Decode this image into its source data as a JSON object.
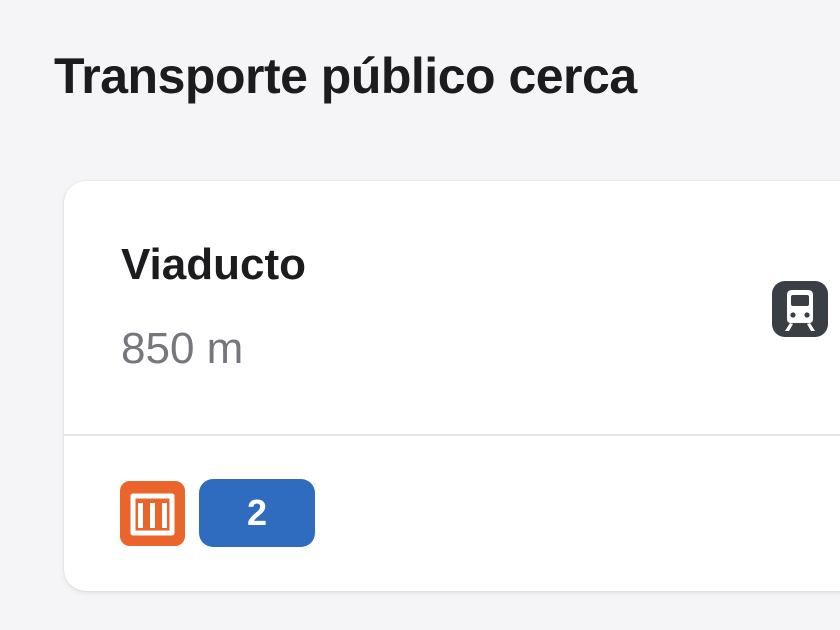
{
  "section": {
    "title": "Transporte público cerca"
  },
  "station": {
    "name": "Viaducto",
    "distance": "850 m",
    "transit_icon": "train-icon",
    "system_logo": "metro-logo-icon",
    "lines": [
      {
        "label": "2",
        "color": "#2f6cc0"
      }
    ]
  },
  "colors": {
    "metro_brand": "#e9652b",
    "line_2": "#2f6cc0",
    "text_primary": "#1c1c1e",
    "text_secondary": "#76767d"
  }
}
